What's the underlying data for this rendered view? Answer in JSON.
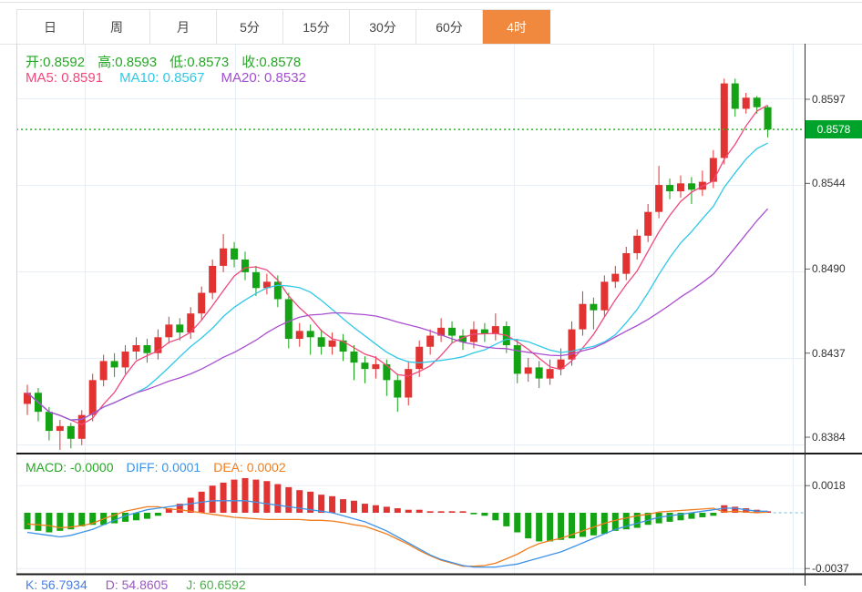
{
  "tabs": {
    "items": [
      {
        "label": "日",
        "active": false
      },
      {
        "label": "周",
        "active": false
      },
      {
        "label": "月",
        "active": false
      },
      {
        "label": "5分",
        "active": false
      },
      {
        "label": "15分",
        "active": false
      },
      {
        "label": "30分",
        "active": false
      },
      {
        "label": "60分",
        "active": false
      },
      {
        "label": "4时",
        "active": true
      }
    ]
  },
  "ohlc_header": {
    "open_label": "开:",
    "open": "0.8592",
    "high_label": "高:",
    "high": "0.8593",
    "low_label": "低:",
    "low": "0.8573",
    "close_label": "收:",
    "close": "0.8578"
  },
  "ma_header": {
    "ma5_label": "MA5:",
    "ma5": "0.8591",
    "ma10_label": "MA10:",
    "ma10": "0.8567",
    "ma20_label": "MA20:",
    "ma20": "0.8532"
  },
  "macd_header": {
    "macd_label": "MACD:",
    "macd": "-0.0000",
    "diff_label": "DIFF:",
    "diff": "0.0001",
    "dea_label": "DEA:",
    "dea": "0.0002"
  },
  "kdj_header": {
    "k_label": "K:",
    "k": "56.7934",
    "d_label": "D:",
    "d": "54.8605",
    "j_label": "J:",
    "j": "60.6592"
  },
  "price_axis": {
    "labels": [
      {
        "text": "0.8597",
        "price": 0.8597
      },
      {
        "text": "0.8544",
        "price": 0.8544
      },
      {
        "text": "0.8490",
        "price": 0.849
      },
      {
        "text": "0.8437",
        "price": 0.8437
      },
      {
        "text": "0.8384",
        "price": 0.8384
      }
    ],
    "current": {
      "text": "0.8578",
      "price": 0.8578
    }
  },
  "macd_axis": {
    "labels": [
      {
        "text": "0.0018",
        "v": 18
      },
      {
        "text": "-0.0037",
        "v": -37
      }
    ]
  },
  "colors": {
    "accent_orange": "#f0883e",
    "up_candle": "#e23333",
    "down_candle": "#14a314",
    "ma5": "#f0497c",
    "ma10": "#2fc8e8",
    "ma20": "#aa4fd0",
    "diff_line": "#3e93e6",
    "dea_line": "#ef7d1f",
    "grid": "#e8eef5",
    "current_price_line": "#2db82d",
    "badge_bg": "#00a32a",
    "axis_line": "#333333",
    "separator": "#1a1a1a",
    "zero_dash": "#8ecae6"
  },
  "chart_data": {
    "type": "candlestick+macd",
    "note": "4-hour candles, values estimated from axis; red = up, green = down",
    "price_ylim": [
      0.8384,
      0.8597
    ],
    "macd_ylim": [
      -0.0037,
      0.0018
    ],
    "grid": true,
    "candles": [
      [
        0.8405,
        0.8417,
        0.8398,
        0.8412
      ],
      [
        0.8412,
        0.8415,
        0.8394,
        0.84
      ],
      [
        0.84,
        0.8403,
        0.8382,
        0.8388
      ],
      [
        0.8388,
        0.8395,
        0.8376,
        0.8391
      ],
      [
        0.8391,
        0.8393,
        0.8377,
        0.8383
      ],
      [
        0.8383,
        0.8401,
        0.8379,
        0.8398
      ],
      [
        0.8398,
        0.8424,
        0.8394,
        0.842
      ],
      [
        0.842,
        0.8436,
        0.8416,
        0.8432
      ],
      [
        0.8432,
        0.8437,
        0.8422,
        0.8428
      ],
      [
        0.8428,
        0.8442,
        0.8424,
        0.8438
      ],
      [
        0.8438,
        0.8447,
        0.8433,
        0.8442
      ],
      [
        0.8442,
        0.8446,
        0.8431,
        0.8437
      ],
      [
        0.8437,
        0.8452,
        0.8433,
        0.8447
      ],
      [
        0.8447,
        0.846,
        0.8443,
        0.8455
      ],
      [
        0.8455,
        0.8459,
        0.8445,
        0.845
      ],
      [
        0.845,
        0.8466,
        0.8446,
        0.8462
      ],
      [
        0.8462,
        0.8479,
        0.8458,
        0.8475
      ],
      [
        0.8475,
        0.8496,
        0.8471,
        0.8492
      ],
      [
        0.8492,
        0.8512,
        0.8488,
        0.8503
      ],
      [
        0.8503,
        0.8507,
        0.8491,
        0.8496
      ],
      [
        0.8496,
        0.8501,
        0.8483,
        0.8488
      ],
      [
        0.8488,
        0.8492,
        0.8473,
        0.8478
      ],
      [
        0.8478,
        0.8487,
        0.8474,
        0.8482
      ],
      [
        0.8482,
        0.8486,
        0.8466,
        0.8471
      ],
      [
        0.8471,
        0.8475,
        0.844,
        0.8446
      ],
      [
        0.8446,
        0.8456,
        0.8441,
        0.8451
      ],
      [
        0.8451,
        0.8455,
        0.8436,
        0.8447
      ],
      [
        0.8447,
        0.8452,
        0.8436,
        0.8441
      ],
      [
        0.8441,
        0.845,
        0.8436,
        0.8445
      ],
      [
        0.8445,
        0.8449,
        0.8432,
        0.8438
      ],
      [
        0.8438,
        0.8442,
        0.842,
        0.8431
      ],
      [
        0.8431,
        0.8435,
        0.8418,
        0.8427
      ],
      [
        0.8427,
        0.8435,
        0.8421,
        0.843
      ],
      [
        0.843,
        0.8433,
        0.841,
        0.842
      ],
      [
        0.842,
        0.8424,
        0.84,
        0.8409
      ],
      [
        0.8409,
        0.8432,
        0.8404,
        0.8427
      ],
      [
        0.8427,
        0.8445,
        0.8422,
        0.8441
      ],
      [
        0.8441,
        0.8452,
        0.8436,
        0.8448
      ],
      [
        0.8448,
        0.8459,
        0.8444,
        0.8453
      ],
      [
        0.8453,
        0.8457,
        0.8443,
        0.8448
      ],
      [
        0.8448,
        0.8452,
        0.8439,
        0.8444
      ],
      [
        0.8444,
        0.8457,
        0.844,
        0.8452
      ],
      [
        0.8452,
        0.8456,
        0.8444,
        0.8449
      ],
      [
        0.8449,
        0.8462,
        0.8445,
        0.8454
      ],
      [
        0.8454,
        0.8457,
        0.8437,
        0.8442
      ],
      [
        0.8442,
        0.8446,
        0.8418,
        0.8424
      ],
      [
        0.8424,
        0.8434,
        0.8419,
        0.8428
      ],
      [
        0.8428,
        0.8432,
        0.8415,
        0.8421
      ],
      [
        0.8421,
        0.8433,
        0.8417,
        0.8427
      ],
      [
        0.8427,
        0.844,
        0.8423,
        0.8433
      ],
      [
        0.8433,
        0.8457,
        0.8429,
        0.8452
      ],
      [
        0.8452,
        0.8476,
        0.8448,
        0.8468
      ],
      [
        0.8468,
        0.8472,
        0.8452,
        0.8464
      ],
      [
        0.8464,
        0.8486,
        0.846,
        0.8482
      ],
      [
        0.8482,
        0.8492,
        0.8478,
        0.8487
      ],
      [
        0.8487,
        0.8504,
        0.8483,
        0.85
      ],
      [
        0.85,
        0.8515,
        0.8496,
        0.8511
      ],
      [
        0.8511,
        0.8531,
        0.8507,
        0.8526
      ],
      [
        0.8526,
        0.8555,
        0.8522,
        0.8543
      ],
      [
        0.8543,
        0.8547,
        0.8534,
        0.8539
      ],
      [
        0.8539,
        0.8549,
        0.8535,
        0.8544
      ],
      [
        0.8544,
        0.8548,
        0.8531,
        0.854
      ],
      [
        0.854,
        0.8552,
        0.8536,
        0.8545
      ],
      [
        0.8545,
        0.8565,
        0.8541,
        0.856
      ],
      [
        0.856,
        0.861,
        0.8556,
        0.8607
      ],
      [
        0.8607,
        0.861,
        0.8586,
        0.8591
      ],
      [
        0.8591,
        0.8601,
        0.8588,
        0.8598
      ],
      [
        0.8598,
        0.8599,
        0.8588,
        0.8592
      ],
      [
        0.8592,
        0.8593,
        0.8573,
        0.8578
      ]
    ],
    "ma_periods": [
      5,
      10,
      20
    ],
    "macd": {
      "hist_1e4": [
        -11,
        -12,
        -13,
        -12,
        -11,
        -9,
        -8,
        -8,
        -7,
        -6,
        -5,
        -4,
        -2,
        3,
        6,
        10,
        14,
        18,
        20,
        22,
        23,
        22,
        21,
        19,
        17,
        15,
        14,
        12,
        11,
        9,
        8,
        6,
        5,
        4,
        3,
        2,
        2,
        1,
        1,
        1,
        1,
        -1,
        -2,
        -5,
        -9,
        -13,
        -17,
        -19,
        -19,
        -18,
        -17,
        -16,
        -15,
        -14,
        -12,
        -11,
        -10,
        -8,
        -7,
        -6,
        -5,
        -4,
        -3,
        -2,
        5,
        4,
        3,
        2,
        1
      ],
      "diff_1e4": [
        -13,
        -14,
        -15,
        -16,
        -15,
        -13,
        -11,
        -8,
        -5,
        -2,
        0,
        2,
        3,
        4,
        5,
        6,
        7,
        8,
        8,
        8,
        8,
        7,
        6,
        5,
        4,
        3,
        2,
        1,
        0,
        -2,
        -4,
        -6,
        -9,
        -12,
        -16,
        -20,
        -24,
        -28,
        -31,
        -33,
        -35,
        -36,
        -36,
        -36,
        -35,
        -34,
        -32,
        -30,
        -28,
        -26,
        -23,
        -20,
        -17,
        -14,
        -11,
        -9,
        -7,
        -5,
        -3,
        -2,
        -1,
        0,
        1,
        2,
        3,
        3,
        2,
        1,
        1
      ]
    }
  }
}
